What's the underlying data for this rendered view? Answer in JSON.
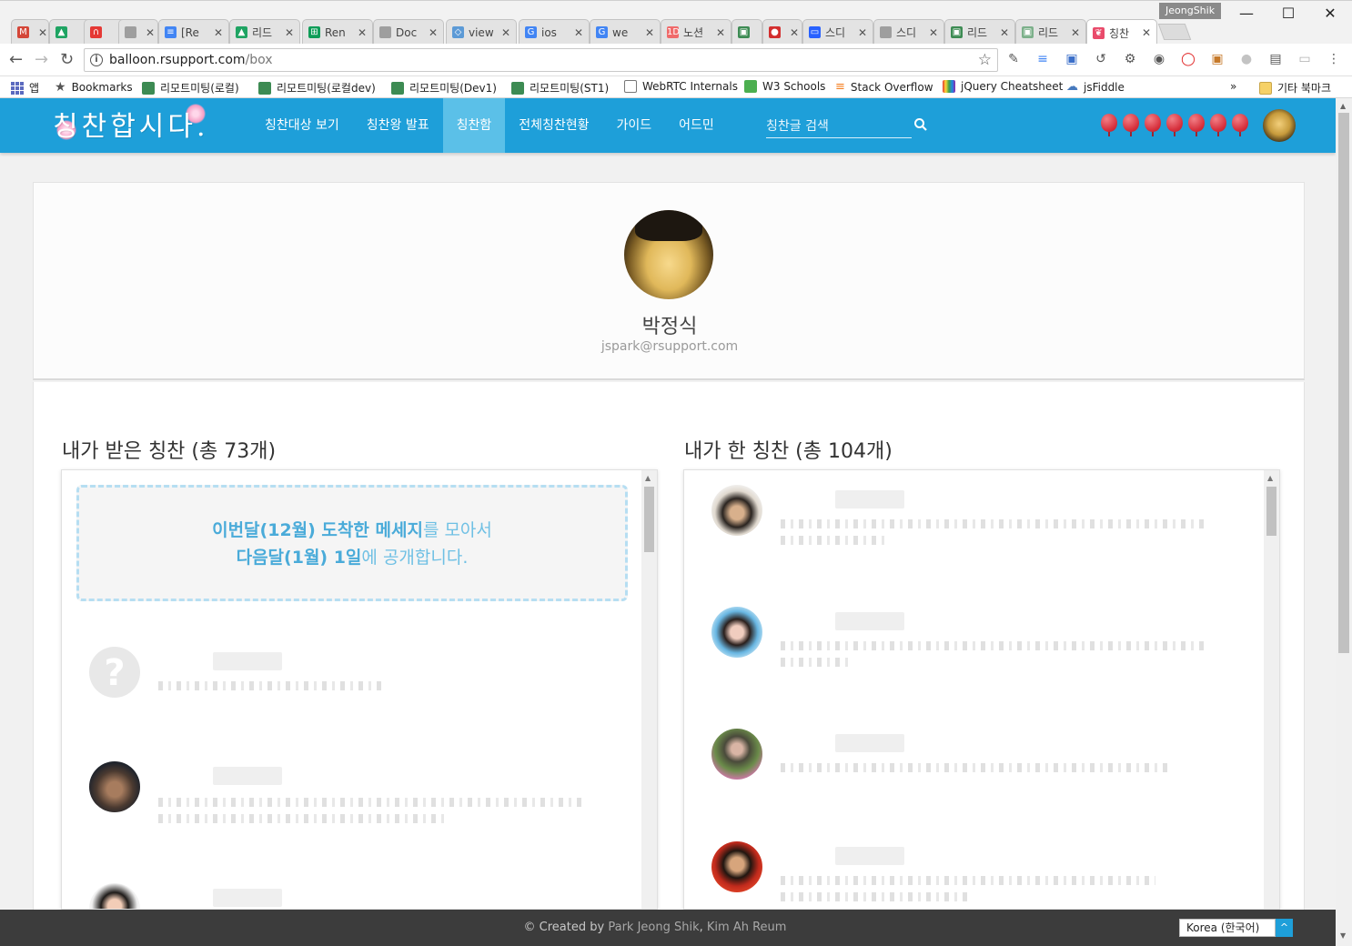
{
  "browser": {
    "profile_name": "JeongShik",
    "tabs": [
      {
        "title": "",
        "favicon_color": "#d44638",
        "favicon_glyph": "M"
      },
      {
        "title": "",
        "favicon_color": "#1fa463",
        "favicon_glyph": "▲"
      },
      {
        "title": "",
        "favicon_color": "#e53935",
        "favicon_glyph": "∩"
      },
      {
        "title": "",
        "favicon_color": "#9e9e9e",
        "favicon_glyph": ""
      },
      {
        "title": "[Re",
        "favicon_color": "#4285f4",
        "favicon_glyph": "≡"
      },
      {
        "title": "리드",
        "favicon_color": "#1fa463",
        "favicon_glyph": "▲"
      },
      {
        "title": "Ren",
        "favicon_color": "#0f9d58",
        "favicon_glyph": "⊞"
      },
      {
        "title": "Doc",
        "favicon_color": "#9e9e9e",
        "favicon_glyph": ""
      },
      {
        "title": "view",
        "favicon_color": "#5c9ad6",
        "favicon_glyph": "◇"
      },
      {
        "title": "ios",
        "favicon_color": "#4285f4",
        "favicon_glyph": "G"
      },
      {
        "title": "we",
        "favicon_color": "#4285f4",
        "favicon_glyph": "G"
      },
      {
        "title": "노션",
        "favicon_color": "#f06a6a",
        "favicon_glyph": "1D"
      },
      {
        "title": "",
        "favicon_color": "#3d8b53",
        "favicon_glyph": "▣"
      },
      {
        "title": "",
        "favicon_color": "#d32f2f",
        "favicon_glyph": "●"
      },
      {
        "title": "스디",
        "favicon_color": "#2962ff",
        "favicon_glyph": "▭"
      },
      {
        "title": "스디",
        "favicon_color": "#9e9e9e",
        "favicon_glyph": ""
      },
      {
        "title": "리드",
        "favicon_color": "#3d8b53",
        "favicon_glyph": "▣"
      },
      {
        "title": "리드",
        "favicon_color": "#7cb08a",
        "favicon_glyph": "▣"
      },
      {
        "title": "칭찬",
        "favicon_color": "#e94b6b",
        "favicon_glyph": "❦"
      }
    ],
    "active_tab_index": 18,
    "url_host": "balloon.rsupport.com",
    "url_path": "/box",
    "bookmarks": [
      {
        "label": "앱",
        "icon": "apps-icon"
      },
      {
        "label": "Bookmarks",
        "icon": "star-icon"
      },
      {
        "label": "리모트미팅(로컬)",
        "icon": "remotemeeting-icon"
      },
      {
        "label": "리모트미팅(로컬dev)",
        "icon": "remotemeeting-icon"
      },
      {
        "label": "리모트미팅(Dev1)",
        "icon": "remotemeeting-icon"
      },
      {
        "label": "리모트미팅(ST1)",
        "icon": "remotemeeting-icon"
      },
      {
        "label": "WebRTC Internals",
        "icon": "page-icon"
      },
      {
        "label": "W3 Schools",
        "icon": "w3-icon"
      },
      {
        "label": "Stack Overflow",
        "icon": "stackoverflow-icon"
      },
      {
        "label": "jQuery Cheatsheet",
        "icon": "jquery-icon"
      },
      {
        "label": "jsFiddle",
        "icon": "cloud-icon"
      }
    ],
    "bookmarks_overflow": "»",
    "other_bookmarks": "기타 북마크"
  },
  "header": {
    "logo_text": "칭찬합시다.",
    "nav": [
      {
        "label": "칭찬대상 보기",
        "active": false
      },
      {
        "label": "칭찬왕 발표",
        "active": false
      },
      {
        "label": "칭찬함",
        "active": true
      },
      {
        "label": "전체칭찬현황",
        "active": false
      },
      {
        "label": "가이드",
        "active": false
      },
      {
        "label": "어드민",
        "active": false
      }
    ],
    "search_placeholder": "칭찬글 검색",
    "balloon_count": 7,
    "accent_color": "#1e9fd9"
  },
  "profile": {
    "name": "박정식",
    "email": "jspark@rsupport.com"
  },
  "received": {
    "title": "내가 받은 칭찬 (총 73개)",
    "notice_line1_bold": "이번달(12월) 도착한 메세지",
    "notice_line1_rest": "를 모아서",
    "notice_line2_bold": "다음달(1월) 1일",
    "notice_line2_rest": "에 공개합니다.",
    "items": [
      {
        "avatar": "unknown-sender-icon",
        "name": "",
        "lines": 1
      },
      {
        "avatar": "sender-photo",
        "name": "",
        "lines": 2
      },
      {
        "avatar": "sender-photo",
        "name": "",
        "lines": 1
      }
    ]
  },
  "sent": {
    "title": "내가 한 칭찬 (총 104개)",
    "items": [
      {
        "avatar": "recipient-photo",
        "name": "",
        "lines": 2
      },
      {
        "avatar": "recipient-photo",
        "name": "",
        "lines": 2
      },
      {
        "avatar": "recipient-photo",
        "name": "",
        "lines": 1
      },
      {
        "avatar": "recipient-photo",
        "name": "",
        "lines": 2
      }
    ]
  },
  "footer": {
    "created_by": "© Created by",
    "author1": "Park Jeong Shik",
    "separator": ",",
    "author2": "Kim Ah Reum",
    "language": "Korea (한국어)",
    "top_button": "^"
  }
}
